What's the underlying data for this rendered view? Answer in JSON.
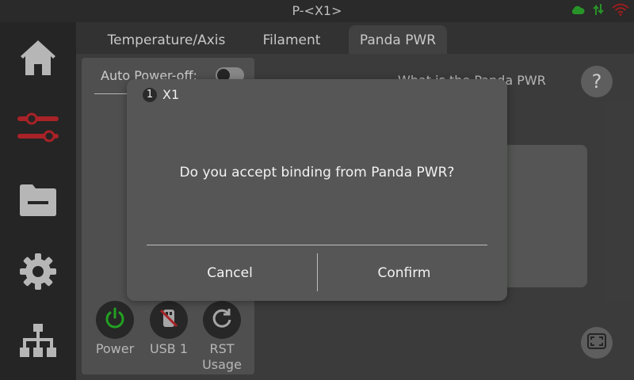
{
  "titlebar": {
    "title": "P-<X1>",
    "icons": [
      "cloud-icon",
      "transfer-arrows-icon",
      "wifi-icon"
    ],
    "colors": {
      "cloud": "#2ea82e",
      "transfer": "#2ea82e",
      "wifi": "#b22222"
    }
  },
  "sidebar": {
    "items": [
      {
        "name": "home",
        "icon": "home-icon"
      },
      {
        "name": "controls",
        "icon": "sliders-icon",
        "active": true
      },
      {
        "name": "files",
        "icon": "folder-icon"
      },
      {
        "name": "settings",
        "icon": "gear-icon"
      },
      {
        "name": "network",
        "icon": "network-icon"
      }
    ],
    "accent": "#c0272d"
  },
  "tabs": [
    {
      "label": "Temperature/Axis"
    },
    {
      "label": "Filament"
    },
    {
      "label": "Panda PWR",
      "active": true
    }
  ],
  "panel": {
    "auto_power_label": "Auto Power-off:",
    "auto_power_on": false,
    "what_is_text": "What is the Panda PWR",
    "help_label": "?",
    "controls": [
      {
        "label": "Power",
        "icon": "power-icon",
        "color": "#27b827"
      },
      {
        "label": "USB 1",
        "icon": "usb-disabled-icon"
      },
      {
        "label": "RST Usage",
        "icon": "reset-icon"
      }
    ]
  },
  "dialog": {
    "badge": "1",
    "device": "X1",
    "message": "Do you accept binding from Panda PWR?",
    "cancel_label": "Cancel",
    "confirm_label": "Confirm"
  }
}
